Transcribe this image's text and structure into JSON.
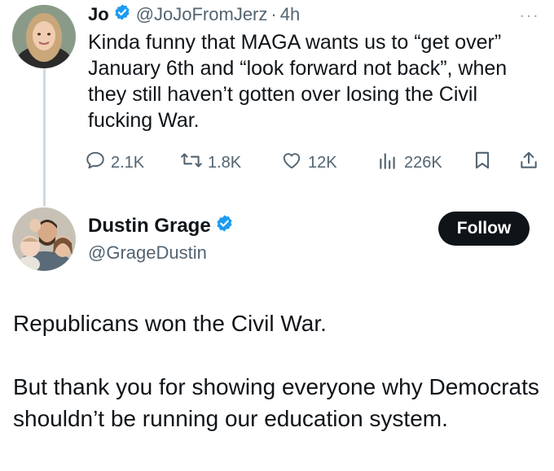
{
  "tweet": {
    "author_name": "Jo",
    "author_handle": "@JoJoFromJerz",
    "separator": "·",
    "time": "4h",
    "more": "···",
    "text": "Kinda funny that MAGA wants us to “get over” January 6th and “look forward not back”, when they still haven’t gotten over losing the Civil fucking War.",
    "stats": {
      "replies": "2.1K",
      "retweets": "1.8K",
      "likes": "12K",
      "views": "226K"
    }
  },
  "reply": {
    "author_name": "Dustin Grage",
    "author_handle": "@GrageDustin",
    "follow_label": "Follow",
    "paragraph1": "Republicans won the Civil War.",
    "paragraph2": "But thank you for showing everyone why Democrats shouldn’t be running our education system."
  },
  "colors": {
    "text": "#0f1419",
    "secondary": "#536471",
    "verified": "#1d9bf0",
    "thread_line": "#cfd9de",
    "follow_bg": "#0f1419"
  },
  "icons": [
    "verified-badge-icon",
    "more-icon",
    "reply-icon",
    "retweet-icon",
    "like-icon",
    "views-icon",
    "bookmark-icon",
    "share-icon"
  ]
}
